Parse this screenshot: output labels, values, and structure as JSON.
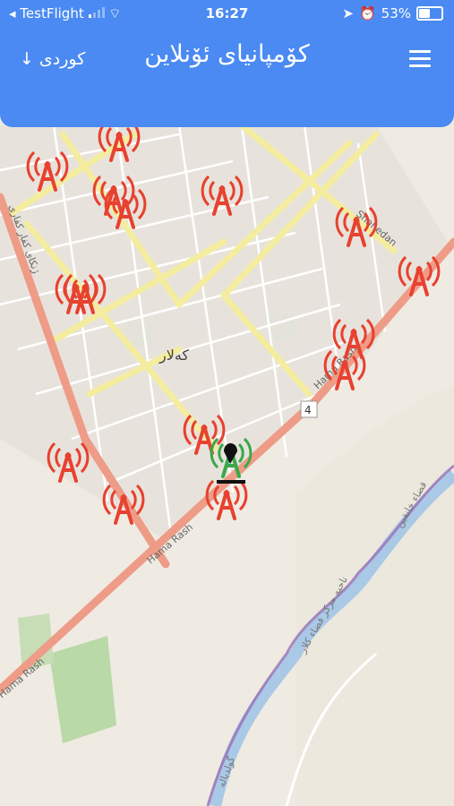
{
  "status_bar": {
    "back_app": "◂ TestFlight",
    "time": "16:27",
    "battery_percent": "53%",
    "battery_level": 0.53
  },
  "header": {
    "language_label": "کوردی",
    "title": "کۆمپانیای ئۆنلاین",
    "bg_color": "#4a8af2"
  },
  "map": {
    "city_label": "کەلار",
    "road_labels": {
      "hama_rash_1": "Hama Rash",
      "hama_rash_2": "Hama Rash",
      "hama_rash_3": "Hama Rash",
      "shahedan": "Shahedan",
      "street_west": "ژنکای کفار کفاری",
      "river_1": "ناحیە مرکز قضاء کلار",
      "river_2": "قضاء خانقین",
      "river_3": "گولدیالە",
      "route_shield": "4"
    },
    "tower_color": "#e8412f",
    "user_color": "#3aa84a"
  }
}
